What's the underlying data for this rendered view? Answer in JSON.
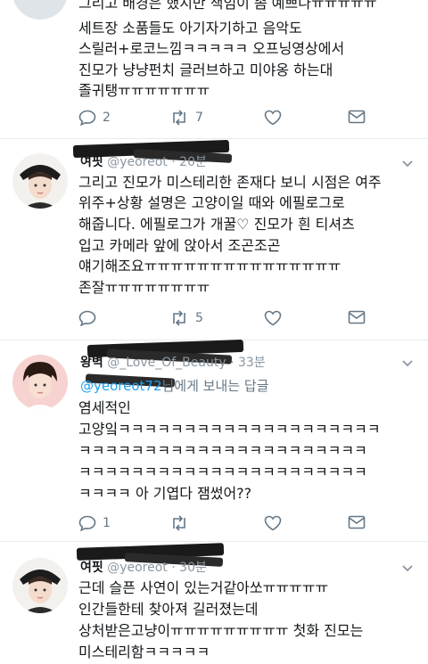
{
  "tweet1": {
    "lines": [
      "그리고 배경은 했지만 책임이 좀 예쁘나ㅠㅠㅠㅠㅠ",
      "세트장 소품들도 아기자기하고 음악도",
      "스릴러+로코느낌ㅋㅋㅋㅋㅋ 오프닝영상에서",
      "진모가 냥냥펀치 글러브하고 미야옹 하는대",
      "졸귀탱ㅠㅠㅠㅠㅠㅠㅠ"
    ],
    "reply_count": "2",
    "retweet_count": "7",
    "like_count": ""
  },
  "tweet2": {
    "name": "여핏",
    "handle": "@yeoreot",
    "time": "· 20분",
    "lines": [
      "그리고 진모가 미스테리한 존재다 보니 시점은 여주",
      "위주+상황 설명은 고양이일 때와 에필로그로",
      "해줍니다. 에필로그가 개꿀♡ 진모가 흰 티셔츠",
      "입고 카메라 앞에 앉아서 조곤조곤",
      "얘기해조요ㅠㅠㅠㅠㅠㅠㅠㅠㅠㅠㅠㅠㅠㅠㅠ",
      "존잘ㅠㅠㅠㅠㅠㅠㅠㅠ"
    ],
    "reply_count": "",
    "retweet_count": "5",
    "like_count": ""
  },
  "tweet3": {
    "name": "왕벽",
    "handle": "@_Love_Of_Beauty",
    "time": "· 33분",
    "reply_to_handle": "@yeoreot72",
    "reply_to_suffix": "님에게 보내는 답글",
    "lines": [
      "염세적인",
      "고양잌ㅋㅋㅋㅋㅋㅋㅋㅋㅋㅋㅋㅋㅋㅋㅋㅋㅋㅋㅋㅋ",
      "ㅋㅋㅋㅋㅋㅋㅋㅋㅋㅋㅋㅋㅋㅋㅋㅋㅋㅋㅋㅋㅋㅋ",
      "ㅋㅋㅋㅋㅋㅋㅋㅋㅋㅋㅋㅋㅋㅋㅋㅋㅋㅋㅋㅋㅋㅋ",
      "ㅋㅋㅋㅋ 아 기엽다 잼썼어??"
    ],
    "reply_count": "1",
    "retweet_count": "",
    "like_count": ""
  },
  "tweet4": {
    "name": "여핏",
    "handle": "@yeoreot",
    "time": "· 30분",
    "lines": [
      "근데 슬픈 사연이 있는거같아쏘ㅠㅠㅠㅠㅠ",
      "인간들한테 찾아져 길러졌는데",
      "상처받은고냥이ㅠㅠㅠㅠㅠㅠㅠㅠㅠ 첫화 진모는",
      "미스테리함ㅋㅋㅋㅋㅋ"
    ]
  },
  "colors": {
    "text": "#14171a",
    "muted": "#657786",
    "link": "#1da1f2",
    "divider": "#e6ecf0"
  },
  "icons": [
    "reply-icon",
    "retweet-icon",
    "like-icon",
    "dm-icon",
    "chevron-down-icon"
  ]
}
